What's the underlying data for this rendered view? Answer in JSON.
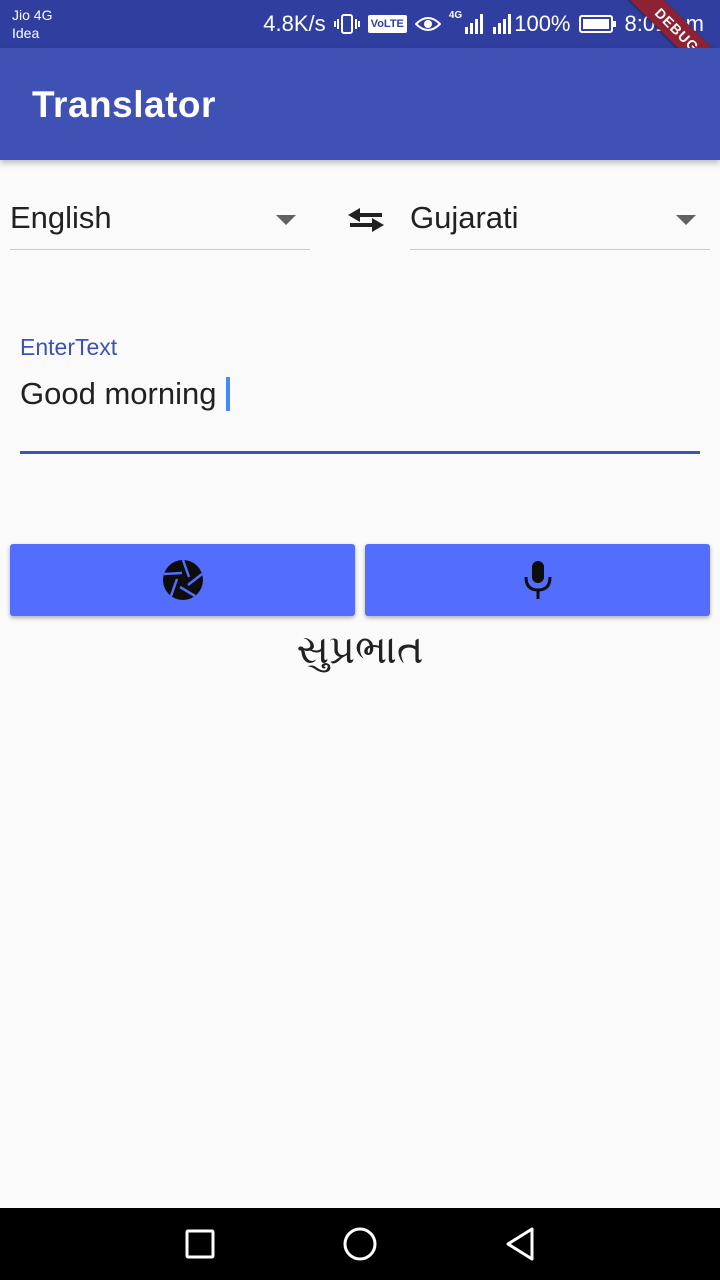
{
  "status_bar": {
    "carrier_1": "Jio 4G",
    "carrier_2": "Idea",
    "network_speed": "4.8K/s",
    "volte": "VoLTE",
    "network_type": "4G",
    "battery": "100%",
    "time": "8:01 am",
    "debug_banner": "DEBUG"
  },
  "app_bar": {
    "title": "Translator"
  },
  "languages": {
    "source": "English",
    "target": "Gujarati"
  },
  "input": {
    "label": "EnterText",
    "value": "Good morning"
  },
  "output": {
    "translated_text": "સુપ્રભાત"
  },
  "icons": {
    "camera": "camera-icon",
    "mic": "microphone-icon",
    "swap": "swap-icon"
  },
  "colors": {
    "status_bar": "#303f9f",
    "app_bar": "#3f51b5",
    "button": "#536dfe",
    "accent": "#448aff",
    "debug": "#8e2233"
  }
}
